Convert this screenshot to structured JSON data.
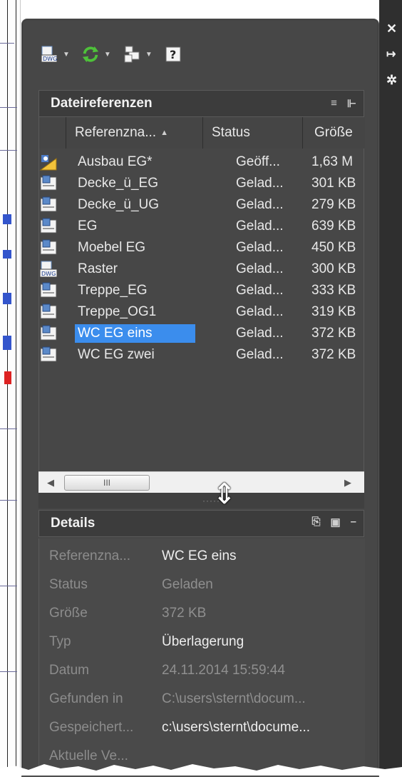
{
  "toolbar": {
    "attach_icon_label": "DWG",
    "items": [
      "attach-dwg",
      "refresh",
      "change-path",
      "help"
    ]
  },
  "side_strip": {
    "close_glyph": "✕",
    "pin_glyph": "↦",
    "settings_glyph": "✲"
  },
  "file_references": {
    "title": "Dateireferenzen",
    "columns": [
      "Referenzna...",
      "Status",
      "Größe"
    ],
    "rows": [
      {
        "icon": "dwg-open-icon",
        "name": "Ausbau EG*",
        "status": "Geöff...",
        "size": "1,63 M"
      },
      {
        "icon": "xref-icon",
        "name": "Decke_ü_EG",
        "status": "Gelad...",
        "size": "301 KB"
      },
      {
        "icon": "xref-icon",
        "name": "Decke_ü_UG",
        "status": "Gelad...",
        "size": "279 KB"
      },
      {
        "icon": "xref-icon",
        "name": "EG",
        "status": "Gelad...",
        "size": "639 KB"
      },
      {
        "icon": "xref-icon",
        "name": "Moebel EG",
        "status": "Gelad...",
        "size": "450 KB"
      },
      {
        "icon": "dwg-icon",
        "name": "Raster",
        "status": "Gelad...",
        "size": "300 KB"
      },
      {
        "icon": "xref-icon",
        "name": "Treppe_EG",
        "status": "Gelad...",
        "size": "333 KB"
      },
      {
        "icon": "xref-icon",
        "name": "Treppe_OG1",
        "status": "Gelad...",
        "size": "319 KB"
      },
      {
        "icon": "xref-icon",
        "name": "WC EG eins",
        "status": "Gelad...",
        "size": "372 KB",
        "selected": true
      },
      {
        "icon": "xref-icon",
        "name": "WC EG zwei",
        "status": "Gelad...",
        "size": "372 KB"
      }
    ],
    "scroll_thumb_grip": "III"
  },
  "details": {
    "title": "Details",
    "collapse_glyph": "–",
    "rows": [
      {
        "label": "Referenzna...",
        "value": "WC EG eins",
        "editable": true
      },
      {
        "label": "Status",
        "value": "Geladen",
        "editable": false
      },
      {
        "label": "Größe",
        "value": "372 KB",
        "editable": false
      },
      {
        "label": "Typ",
        "value": "Überlagerung",
        "editable": true
      },
      {
        "label": "Datum",
        "value": "24.11.2014 15:59:44",
        "editable": false
      },
      {
        "label": "Gefunden in",
        "value": "C:\\users\\sternt\\docum...",
        "editable": false
      },
      {
        "label": "Gespeichert...",
        "value": "c:\\users\\sternt\\docume...",
        "editable": true
      },
      {
        "label": "Aktuelle Ve...",
        "value": "",
        "editable": false
      }
    ]
  },
  "colors": {
    "panel_bg": "#474747",
    "header_bg": "#3c3c3c",
    "selection": "#3b8ded",
    "text": "#e8e8e8",
    "muted_text": "#8c8c8c"
  }
}
